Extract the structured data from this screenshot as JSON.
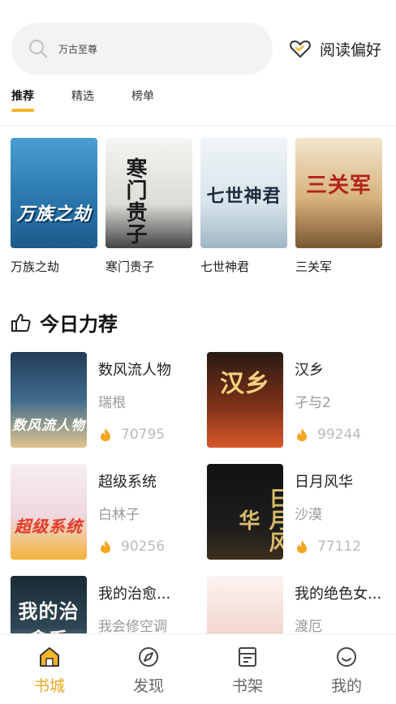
{
  "search": {
    "placeholder": "万古至尊"
  },
  "header": {
    "preference_label": "阅读偏好"
  },
  "tabs": [
    {
      "label": "推荐",
      "active": true
    },
    {
      "label": "精选",
      "active": false
    },
    {
      "label": "榜单",
      "active": false
    }
  ],
  "top_books": [
    {
      "title": "万族之劫",
      "cover_text": "万族之劫"
    },
    {
      "title": "寒门贵子",
      "cover_text": "寒门贵子"
    },
    {
      "title": "七世神君",
      "cover_text": "七世神君"
    },
    {
      "title": "三关军",
      "cover_text": "三关军"
    }
  ],
  "section": {
    "title": "今日力荐",
    "icon": "thumbs-up-icon"
  },
  "recommend": [
    {
      "title": "数风流人物",
      "author": "瑞根",
      "hot": "70795",
      "cover_text": "数风流人物"
    },
    {
      "title": "汉乡",
      "author": "孑与2",
      "hot": "99244",
      "cover_text": "汉乡"
    },
    {
      "title": "超级系统",
      "author": "白林子",
      "hot": "90256",
      "cover_text": "超级系统"
    },
    {
      "title": "日月风华",
      "author": "沙漠",
      "hot": "77112",
      "cover_text": "日月风华"
    },
    {
      "title": "我的治愈...",
      "author": "我会修空调",
      "cover_text": "我的治愈系"
    },
    {
      "title": "我的绝色女...",
      "author": "渡厄",
      "cover_text": ""
    }
  ],
  "bottom_nav": [
    {
      "label": "书城",
      "icon": "bookstore-icon",
      "active": true
    },
    {
      "label": "发现",
      "icon": "discover-icon",
      "active": false
    },
    {
      "label": "书架",
      "icon": "bookshelf-icon",
      "active": false
    },
    {
      "label": "我的",
      "icon": "profile-icon",
      "active": false
    }
  ],
  "colors": {
    "accent": "#f7b52b",
    "hot_flame": "#f6a623",
    "active_nav": "#f0a81c"
  }
}
